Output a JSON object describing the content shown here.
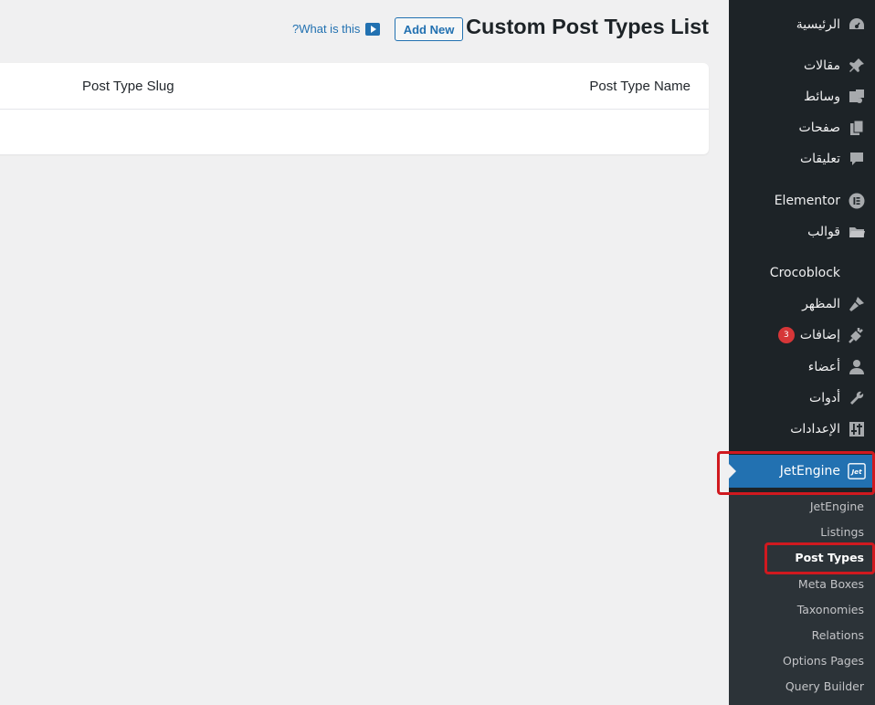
{
  "page": {
    "title": "Custom Post Types List",
    "add_new_label": "Add New",
    "help_link_label": "?What is this",
    "icons": {
      "help": "play-icon"
    }
  },
  "table": {
    "columns": [
      "Post Type Name",
      "Post Type Slug"
    ],
    "rows": []
  },
  "sidebar": {
    "items": [
      {
        "label": "الرئيسية",
        "icon": "dashboard-icon"
      },
      {
        "label": "مقالات",
        "icon": "pin-icon"
      },
      {
        "label": "وسائط",
        "icon": "media-icon"
      },
      {
        "label": "صفحات",
        "icon": "pages-icon"
      },
      {
        "label": "تعليقات",
        "icon": "comment-icon"
      },
      {
        "label": "Elementor",
        "icon": "elementor-icon"
      },
      {
        "label": "قوالب",
        "icon": "folder-icon"
      },
      {
        "label": "Crocoblock",
        "icon": "crocoblock-icon"
      },
      {
        "label": "المظهر",
        "icon": "brush-icon"
      },
      {
        "label": "إضافات",
        "icon": "plugin-icon",
        "badge": "3"
      },
      {
        "label": "أعضاء",
        "icon": "user-icon"
      },
      {
        "label": "أدوات",
        "icon": "wrench-icon"
      },
      {
        "label": "الإعدادات",
        "icon": "settings-icon"
      },
      {
        "label": "JetEngine",
        "icon": "jet-icon",
        "active": true
      }
    ],
    "submenu": [
      {
        "label": "JetEngine"
      },
      {
        "label": "Listings"
      },
      {
        "label": "Post Types",
        "current": true
      },
      {
        "label": "Meta Boxes"
      },
      {
        "label": "Taxonomies"
      },
      {
        "label": "Relations"
      },
      {
        "label": "Options Pages"
      },
      {
        "label": "Query Builder"
      }
    ]
  },
  "colors": {
    "sidebar_bg": "#1d2327",
    "submenu_bg": "#2c3338",
    "accent": "#2271b1",
    "highlight": "#d0191f",
    "badge": "#d63638"
  }
}
